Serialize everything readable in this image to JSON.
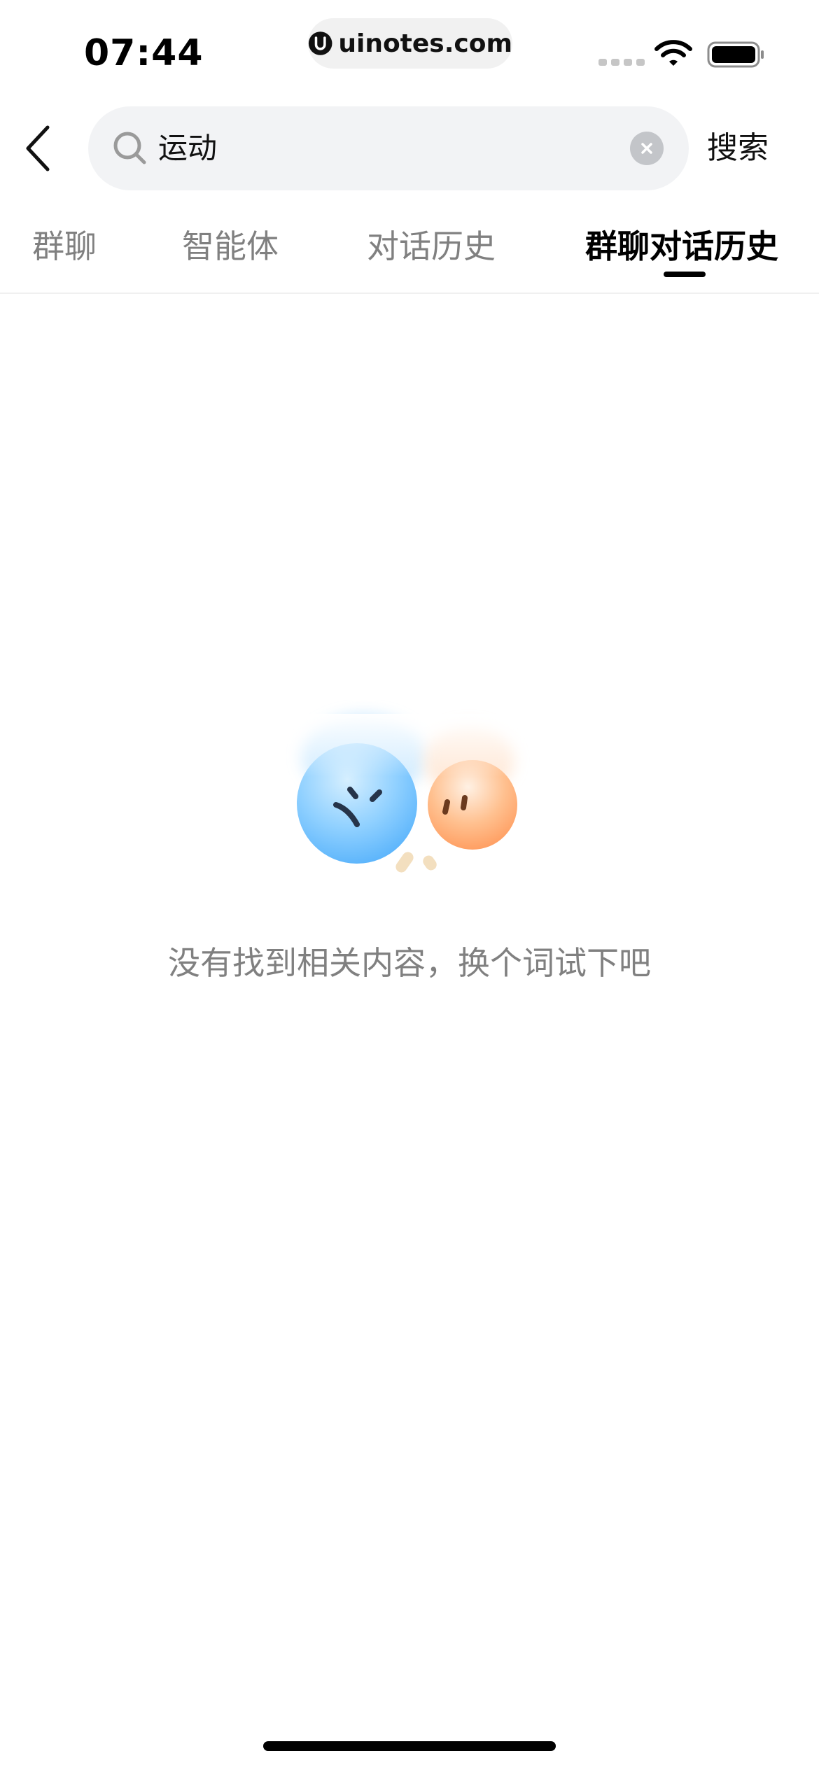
{
  "status_bar": {
    "time": "07:44",
    "url": "uinotes.com",
    "icons": [
      "signal-icon",
      "wifi-icon",
      "battery-icon"
    ]
  },
  "search": {
    "back_icon": "chevron-left-icon",
    "query": "运动",
    "clear_icon": "clear-icon",
    "submit_label": "搜索"
  },
  "tabs": [
    {
      "label": "群聊",
      "active": false
    },
    {
      "label": "智能体",
      "active": false
    },
    {
      "label": "对话历史",
      "active": false
    },
    {
      "label": "群聊对话历史",
      "active": true
    }
  ],
  "empty_state": {
    "illustration": "sad-faces-illustration",
    "message": "没有找到相关内容，换个词试下吧"
  },
  "colors": {
    "text_primary": "#000000",
    "text_secondary": "#808080",
    "search_bg": "#f2f3f5",
    "face_blue": "#6cc1ff",
    "face_orange": "#ffa36b"
  }
}
